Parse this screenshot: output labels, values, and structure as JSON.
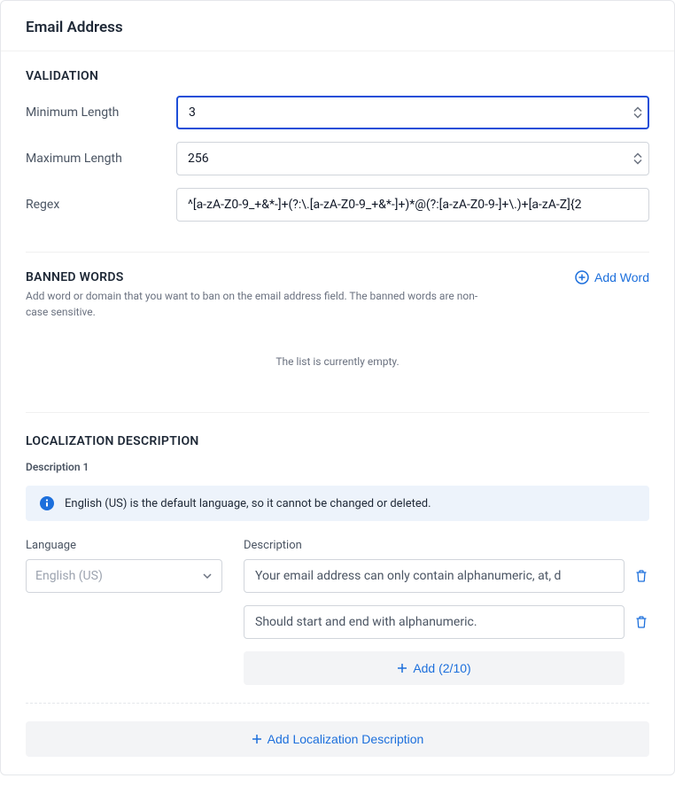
{
  "header": {
    "title": "Email Address"
  },
  "validation": {
    "section_title": "VALIDATION",
    "min_label": "Minimum Length",
    "min_value": "3",
    "max_label": "Maximum Length",
    "max_value": "256",
    "regex_label": "Regex",
    "regex_value": "^[a-zA-Z0-9_+&*-]+(?:\\.[a-zA-Z0-9_+&*-]+)*@(?:[a-zA-Z0-9-]+\\.)+[a-zA-Z]{2"
  },
  "banned": {
    "section_title": "BANNED WORDS",
    "subtitle": "Add word or domain that you want to ban on the email address field. The banned words are non-case sensitive.",
    "add_word_label": "Add Word",
    "empty_text": "The list is currently empty."
  },
  "localization": {
    "section_title": "LOCALIZATION DESCRIPTION",
    "description_label": "Description 1",
    "info_text": "English (US) is the default language, so it cannot be changed or deleted.",
    "language_label": "Language",
    "language_value": "English (US)",
    "description_col_label": "Description",
    "descriptions": [
      "Your email address can only contain alphanumeric, at, d",
      "Should start and end with alphanumeric."
    ],
    "add_inline_label": "Add (2/10)",
    "add_localization_label": "Add Localization Description"
  }
}
